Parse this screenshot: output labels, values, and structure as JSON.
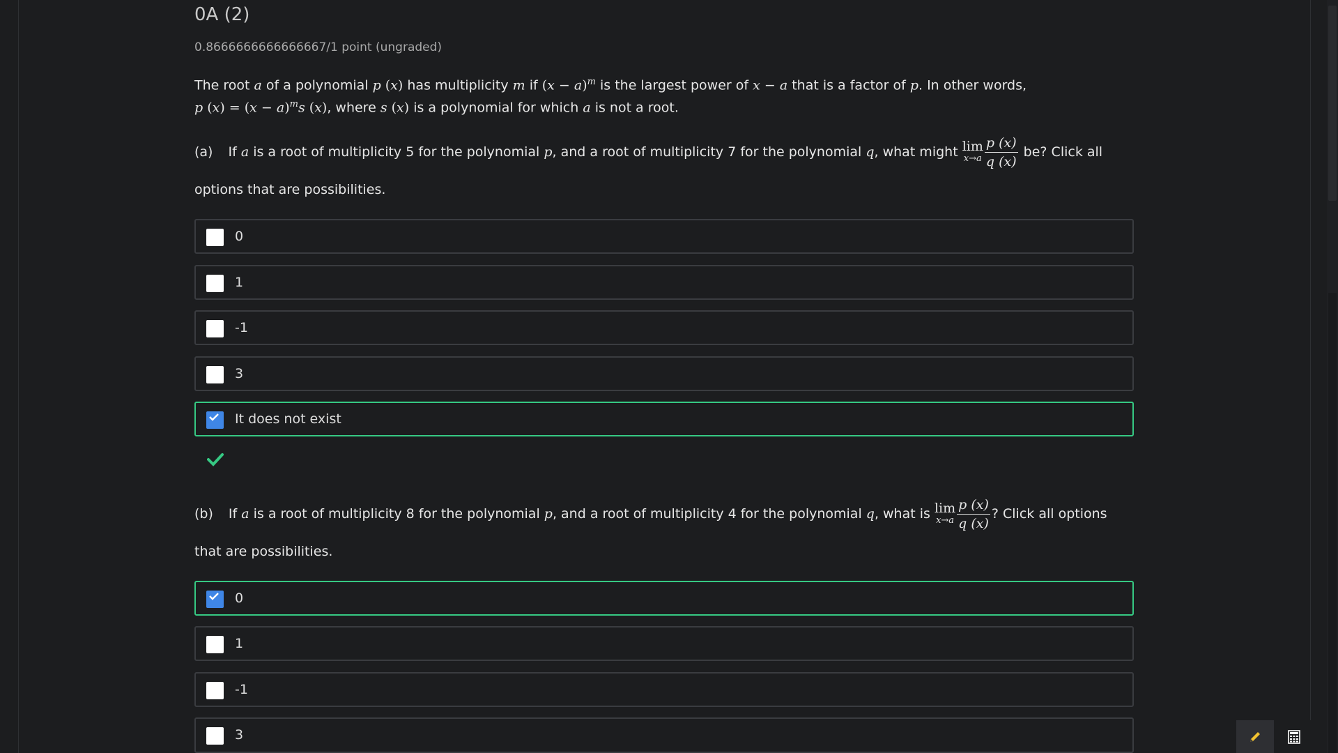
{
  "page": {
    "title": "0A (2)",
    "score": "0.8666666666666667/1 point (ungraded)"
  },
  "intro": {
    "t1": "The root",
    "t2": "of a polynomial",
    "t3": "has multiplicity",
    "t4": "if",
    "t5": "is the largest power of",
    "t6": "that is a factor of",
    "t7": ". In other words,",
    "t8": ", where",
    "t9": "is a polynomial for which",
    "t10": "is not a root."
  },
  "part_a": {
    "label": "(a)",
    "t1": "If",
    "t2": "is a root of multiplicity 5 for the polynomial",
    "t3": ", and a root of multiplicity 7 for the polynomial",
    "t4": ", what might",
    "t5": "be? Click all",
    "t6": "options that are possibilities.",
    "options": [
      {
        "label": "0",
        "checked": false
      },
      {
        "label": "1",
        "checked": false
      },
      {
        "label": "-1",
        "checked": false
      },
      {
        "label": "3",
        "checked": false
      },
      {
        "label": "It does not exist",
        "checked": true
      }
    ]
  },
  "part_b": {
    "label": "(b)",
    "t1": "If",
    "t2": "is a root of multiplicity 8 for the polynomial",
    "t3": ", and a root of multiplicity 4 for the polynomial",
    "t4": ", what is",
    "t5": "? Click all options",
    "t6": "that are possibilities.",
    "options": [
      {
        "label": "0",
        "checked": true
      },
      {
        "label": "1",
        "checked": false
      },
      {
        "label": "-1",
        "checked": false
      },
      {
        "label": "3",
        "checked": false
      }
    ]
  },
  "colors": {
    "background": "#1c1d1f",
    "correct_border": "#36c983",
    "checked_box": "#3f86e6",
    "pencil_icon": "#f2c230"
  },
  "icons": {
    "correct": "checkmark-icon",
    "pencil": "pencil-icon",
    "calculator": "calculator-icon"
  }
}
